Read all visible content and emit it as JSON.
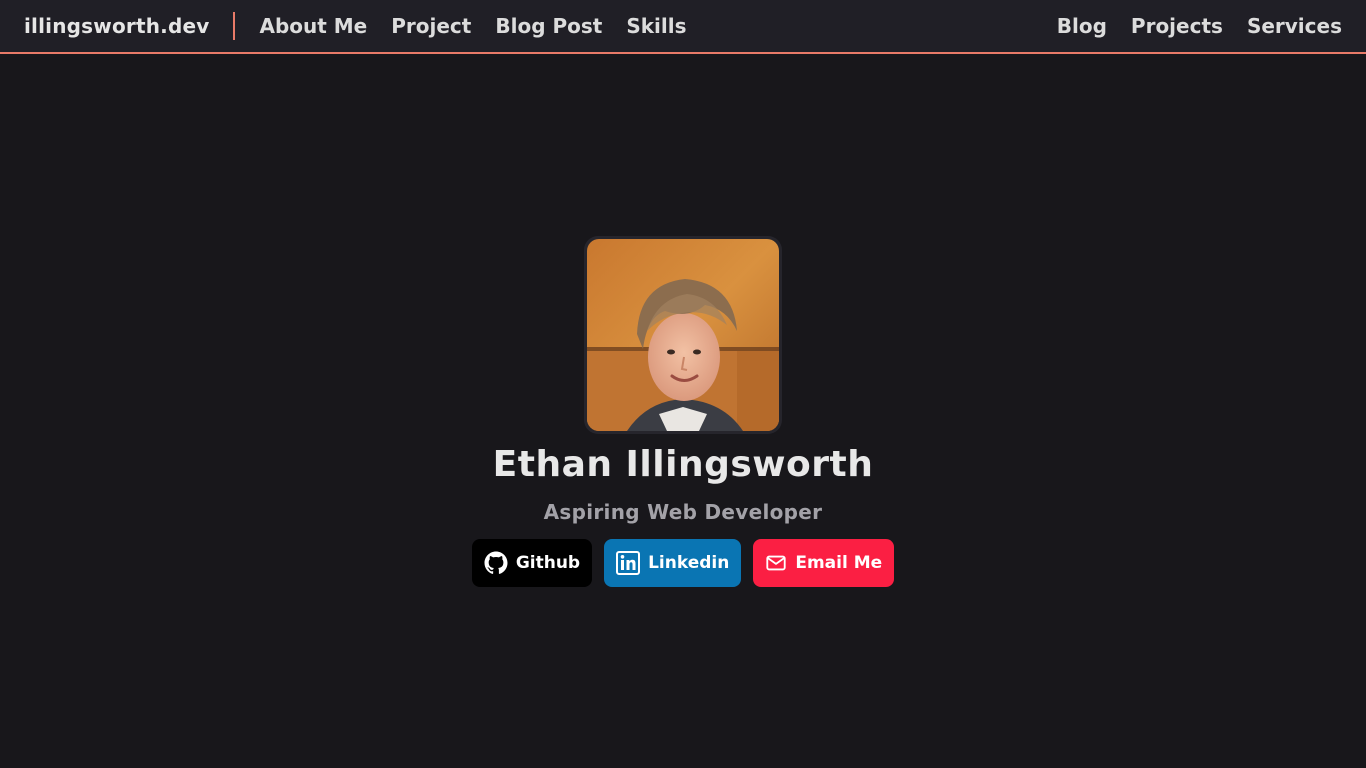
{
  "navbar": {
    "brand": "illingsworth.dev",
    "left_links": [
      "About Me",
      "Project",
      "Blog Post",
      "Skills"
    ],
    "right_links": [
      "Blog",
      "Projects",
      "Services"
    ],
    "accent_color": "#e87a68"
  },
  "profile": {
    "name": "Ethan Illingsworth",
    "tagline": "Aspiring Web Developer",
    "avatar_alt": "Portrait photo"
  },
  "socials": {
    "github_label": "Github",
    "linkedin_label": "Linkedin",
    "email_label": "Email Me",
    "github_color": "#000000",
    "linkedin_color": "#0a75b3",
    "email_color": "#fb1f43",
    "github_icon": "github-icon",
    "linkedin_icon": "linkedin-icon",
    "email_icon": "mail-icon"
  }
}
